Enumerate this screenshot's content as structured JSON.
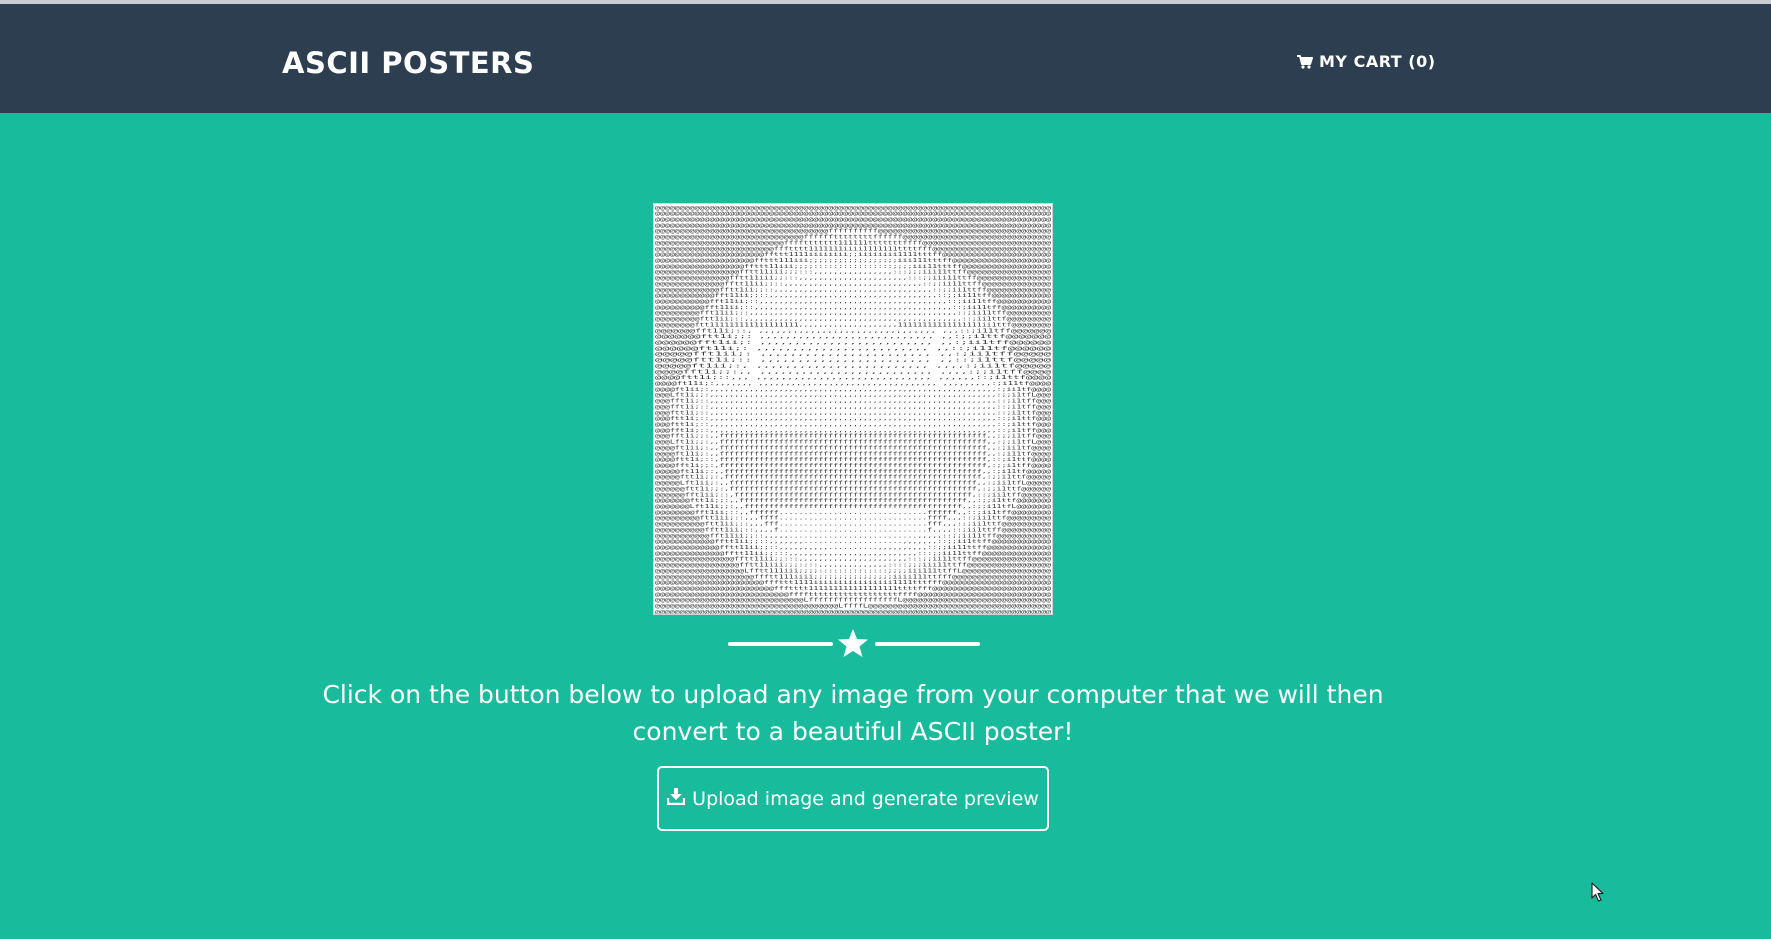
{
  "header": {
    "brand": "ASCII POSTERS",
    "cart_label": "MY CART (0)",
    "cart_icon": "shopping-cart-icon"
  },
  "poster": {
    "icon": "ascii-art-preview",
    "glyphs": [
      "@",
      "G",
      "C",
      "L",
      "f",
      "t",
      "1",
      "i",
      ";",
      ":",
      ",",
      "."
    ]
  },
  "divider": {
    "icon": "star-icon"
  },
  "intro": {
    "text": "Click on the button below to upload any image from your computer that we will then convert to a beautiful ASCII poster!"
  },
  "upload": {
    "label": "Upload image and generate preview",
    "icon": "download-icon"
  },
  "colors": {
    "navbar": "#2c3e50",
    "background": "#18bc9c",
    "text": "#ffffff"
  }
}
